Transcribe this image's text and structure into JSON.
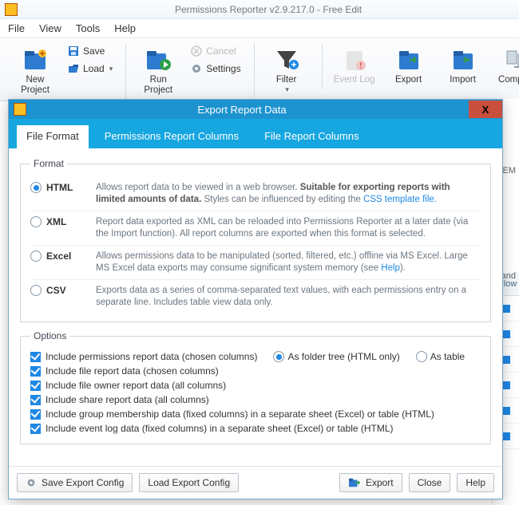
{
  "window": {
    "title": "Permissions Reporter v2.9.217.0 - Free Edit"
  },
  "menu": {
    "file": "File",
    "view": "View",
    "tools": "Tools",
    "help": "Help"
  },
  "ribbon": {
    "new_project": "New Project",
    "save": "Save",
    "load": "Load",
    "run_project": "Run Project",
    "cancel": "Cancel",
    "settings": "Settings",
    "filter": "Filter",
    "event_log": "Event Log",
    "export": "Export",
    "import": "Import",
    "compare": "Compare"
  },
  "bg": {
    "col_allow": "Allow",
    "frag_em": "EM",
    "frag_and": ", and"
  },
  "dialog": {
    "title": "Export Report Data",
    "close": "X",
    "tabs": {
      "file_format": "File Format",
      "perm_cols": "Permissions Report Columns",
      "file_cols": "File Report Columns"
    },
    "format": {
      "legend": "Format",
      "html": {
        "label": "HTML",
        "desc1": "Allows report data to be viewed in a web browser. ",
        "bold": "Suitable for exporting reports with limited amounts of data.",
        "desc2": " Styles can be influenced by editing the ",
        "link": "CSS template file",
        "desc3": "."
      },
      "xml": {
        "label": "XML",
        "desc": "Report data exported as XML can be reloaded into Permissions Reporter at a later date (via the Import function). All report columns are exported when this format is selected."
      },
      "excel": {
        "label": "Excel",
        "desc1": "Allows permissions data to be manipulated (sorted, filtered, etc.) offline via MS Excel. Large MS Excel data exports may consume significant system memory (see ",
        "link": "Help",
        "desc2": ")."
      },
      "csv": {
        "label": "CSV",
        "desc": "Exports data as a series of comma-separated text values, with each permissions entry on a separate line. Includes table view data only."
      }
    },
    "options": {
      "legend": "Options",
      "opt1": "Include permissions report data (chosen columns)",
      "opt1a": "As folder tree (HTML only)",
      "opt1b": "As table",
      "opt2": "Include file report data (chosen columns)",
      "opt3": "Include file owner report data (all columns)",
      "opt4": "Include share report data (all columns)",
      "opt5": "Include group membership data (fixed columns) in a separate sheet (Excel) or table (HTML)",
      "opt6": "Include event log data (fixed columns) in a separate sheet (Excel) or table (HTML)"
    },
    "footer": {
      "save_config": "Save Export Config",
      "load_config": "Load Export Config",
      "export": "Export",
      "close": "Close",
      "help": "Help"
    }
  }
}
